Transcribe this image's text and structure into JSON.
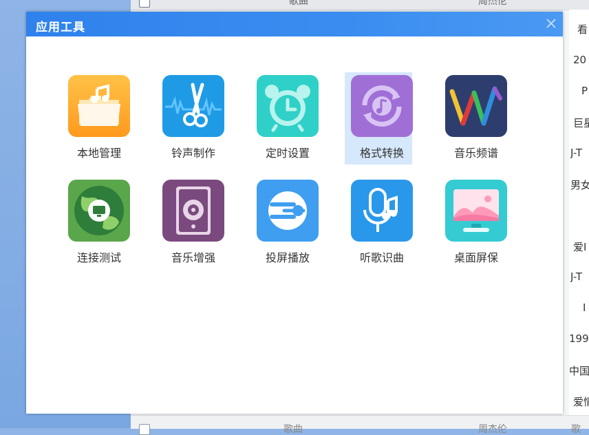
{
  "background": {
    "top_columns": [
      "歌曲",
      "周杰伦"
    ],
    "right_column_cells": [
      "看",
      "20",
      "P",
      "巨星",
      "J-T",
      "男女",
      "",
      "爱I",
      "J-T",
      "I",
      "199",
      "中国",
      "爱情"
    ],
    "bottom_columns": [
      "歌曲",
      "周杰伦",
      "歌"
    ]
  },
  "dialog": {
    "title": "应用工具",
    "close_icon": "close-icon",
    "tools": [
      {
        "label": "本地管理",
        "icon": "folder-music-icon"
      },
      {
        "label": "铃声制作",
        "icon": "scissors-wave-icon"
      },
      {
        "label": "定时设置",
        "icon": "alarm-clock-icon"
      },
      {
        "label": "格式转换",
        "icon": "music-convert-icon",
        "selected": true
      },
      {
        "label": "音乐频谱",
        "icon": "spectrum-w-icon"
      },
      {
        "label": "连接测试",
        "icon": "globe-monitor-icon"
      },
      {
        "label": "音乐增强",
        "icon": "speaker-icon"
      },
      {
        "label": "投屏播放",
        "icon": "cast-icon"
      },
      {
        "label": "听歌识曲",
        "icon": "mic-note-icon"
      },
      {
        "label": "桌面屏保",
        "icon": "monitor-landscape-icon"
      }
    ]
  }
}
